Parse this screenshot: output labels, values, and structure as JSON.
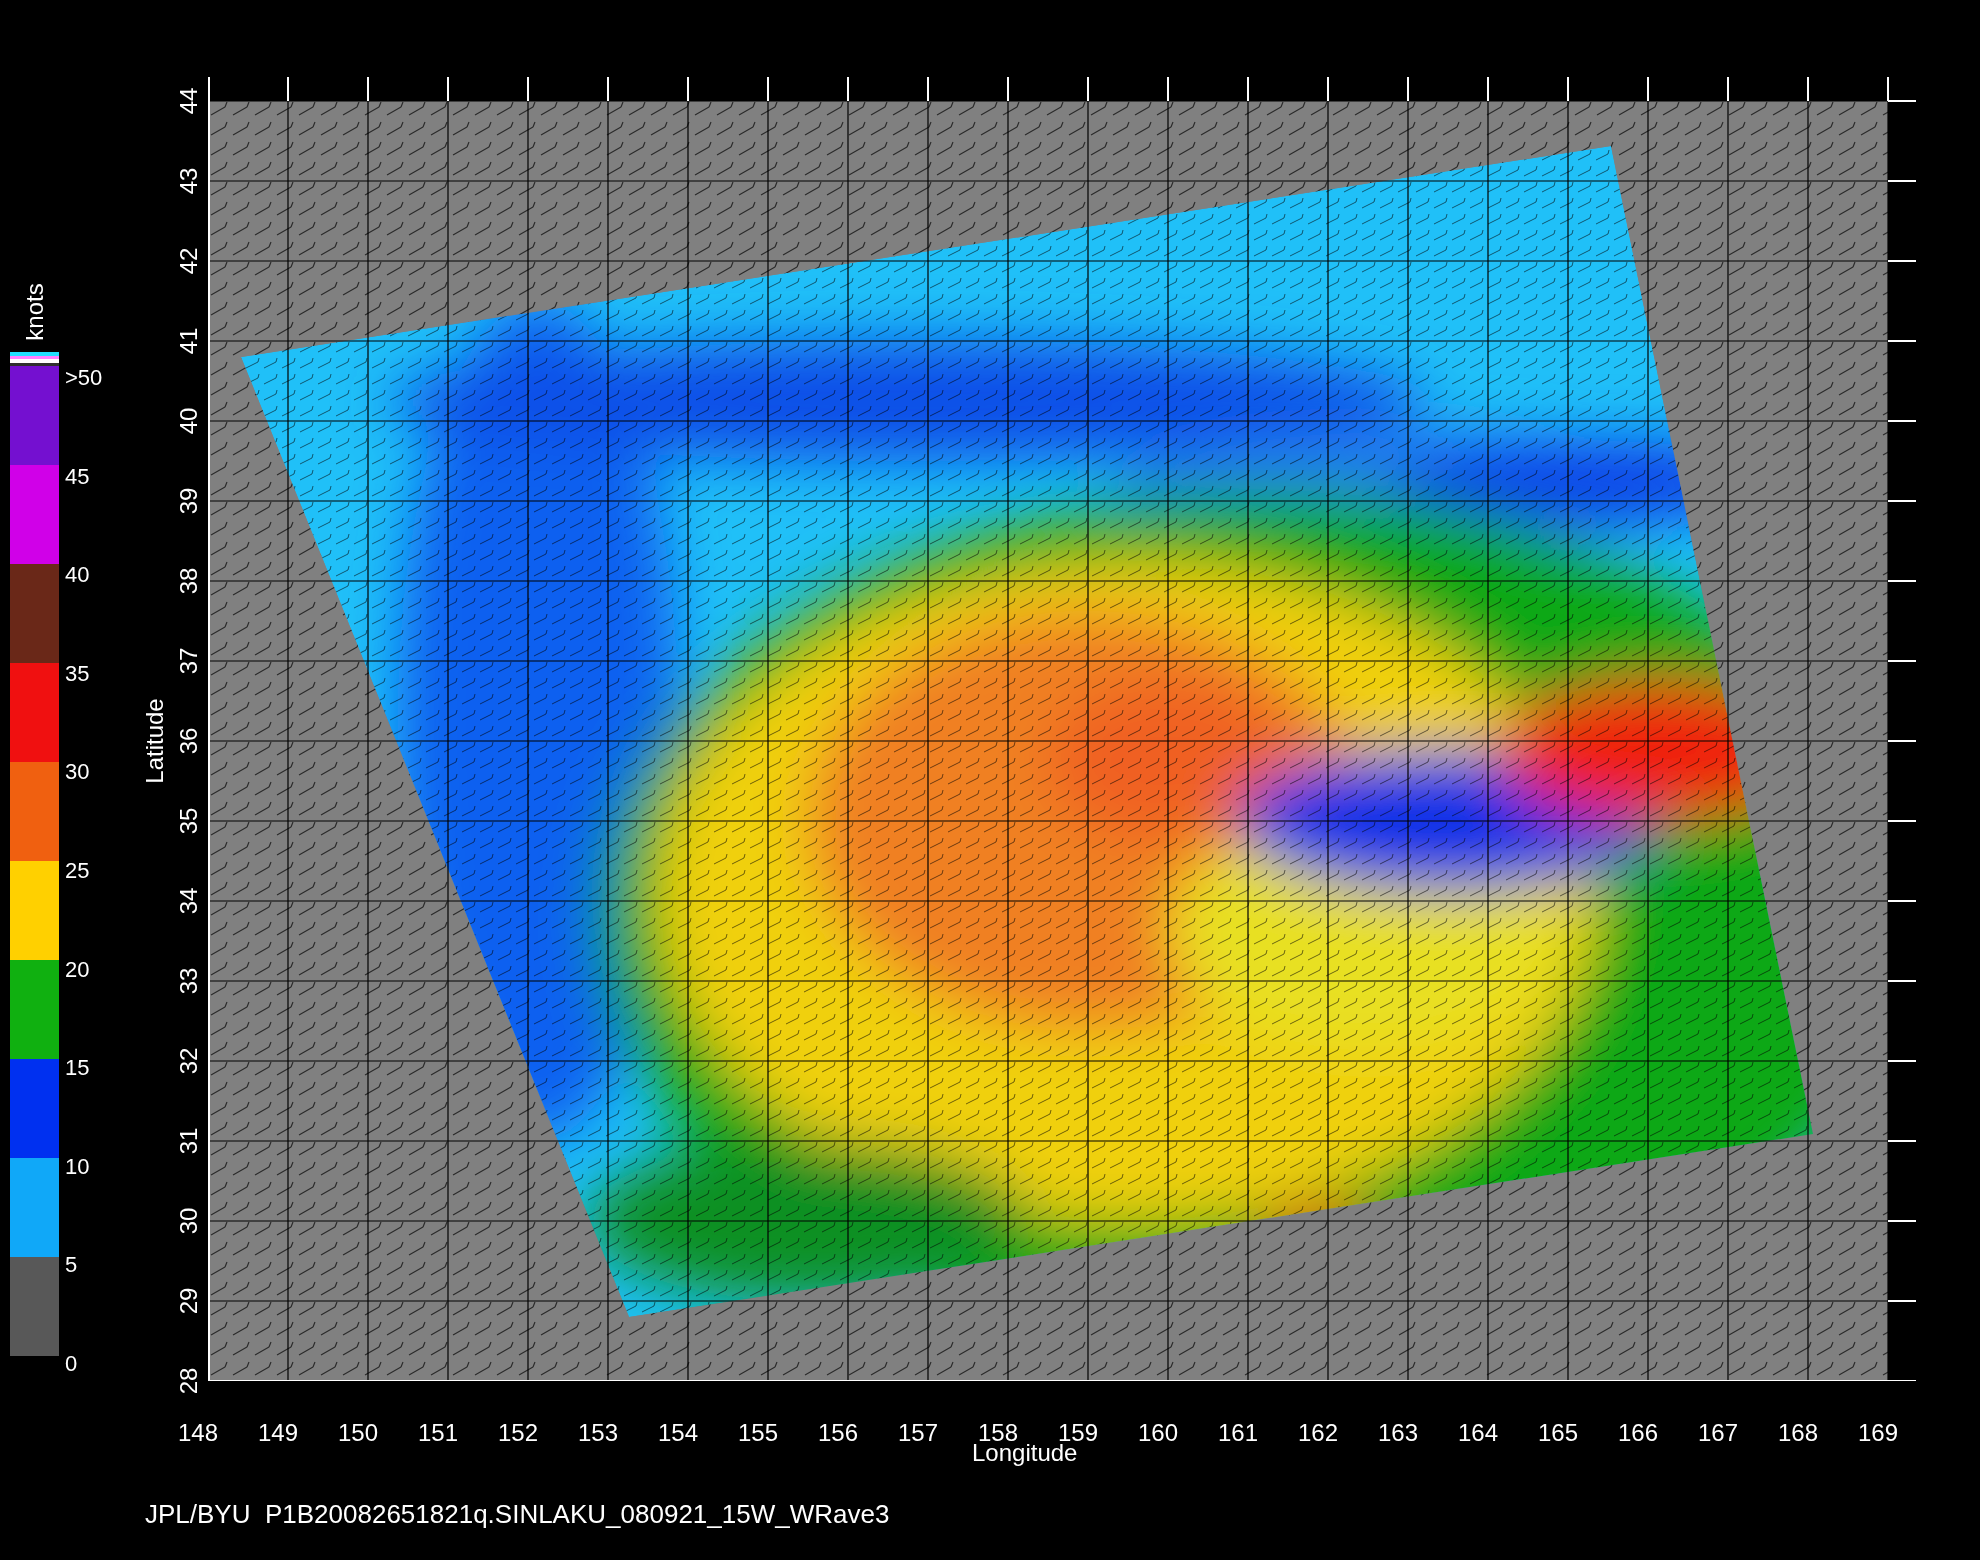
{
  "colorbar": {
    "unit": "knots",
    "bins": [
      {
        "color": "#7410d0"
      },
      {
        "color": "#d000e8"
      },
      {
        "color": "#6a2818"
      },
      {
        "color": "#f01010"
      },
      {
        "color": "#f06010"
      },
      {
        "color": "#ffd000"
      },
      {
        "color": "#10b010"
      },
      {
        "color": "#0030f0"
      },
      {
        "color": "#10a8f8"
      },
      {
        "color": "#585858"
      }
    ],
    "scale_labels": [
      ">50",
      "45",
      "40",
      "35",
      "30",
      "25",
      "20",
      "15",
      "10",
      "5",
      "0"
    ]
  },
  "map": {
    "y_axis": {
      "label": "Latitude",
      "ticks": [
        "44",
        "43",
        "42",
        "41",
        "40",
        "39",
        "38",
        "37",
        "36",
        "35",
        "34",
        "33",
        "32",
        "31",
        "30",
        "29",
        "28"
      ]
    },
    "x_axis": {
      "label": "Longitude",
      "ticks": [
        "148",
        "149",
        "150",
        "151",
        "152",
        "153",
        "154",
        "155",
        "156",
        "157",
        "158",
        "159",
        "160",
        "161",
        "162",
        "163",
        "164",
        "165",
        "166",
        "167",
        "168",
        "169"
      ]
    }
  },
  "caption": "JPL/BYU  P1B20082651821q.SINLAKU_080921_15W_WRave3"
}
